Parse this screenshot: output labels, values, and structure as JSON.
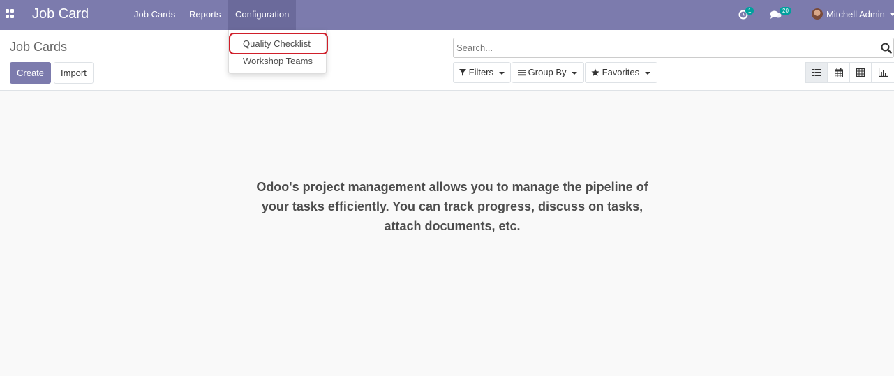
{
  "navbar": {
    "app_title": "Job Card",
    "menu": [
      {
        "label": "Job Cards"
      },
      {
        "label": "Reports"
      },
      {
        "label": "Configuration"
      }
    ],
    "activity_count": "1",
    "message_count": "20",
    "user_name": "Mitchell Admin"
  },
  "config_dropdown": {
    "items": [
      {
        "label": "Quality Checklist",
        "highlighted": true
      },
      {
        "label": "Workshop Teams"
      }
    ]
  },
  "control_panel": {
    "title": "Job Cards",
    "create_label": "Create",
    "import_label": "Import",
    "search_placeholder": "Search...",
    "filters_label": "Filters",
    "group_by_label": "Group By",
    "favorites_label": "Favorites",
    "views": [
      "list-view-icon",
      "calendar-view-icon",
      "pivot-view-icon",
      "graph-view-icon"
    ],
    "active_view": "list-view-icon"
  },
  "helper": {
    "line1": "Odoo's project management allows you to manage the pipeline of",
    "line2": "your tasks efficiently. You can track progress, discuss on tasks,",
    "line3": "attach documents, etc."
  },
  "colors": {
    "navbar": "#7c7bad",
    "badge": "#00a09d",
    "highlight_border": "#d01f2a"
  }
}
